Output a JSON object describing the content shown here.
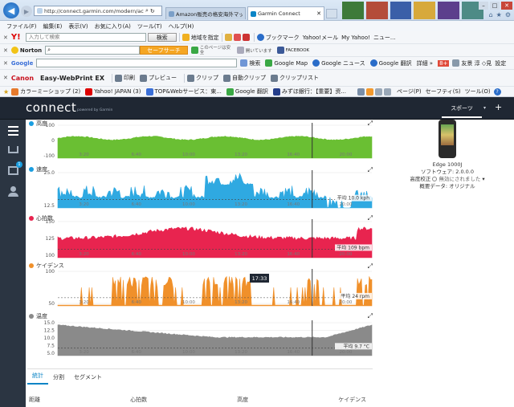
{
  "browser": {
    "url": "http://connect.garmin.com/modern/activity/",
    "tabs": [
      {
        "label": "Amazon販売の格安海外マッ...",
        "active": false
      },
      {
        "label": "Garmin Connect",
        "active": true
      }
    ],
    "menu": [
      "ファイル(F)",
      "編集(E)",
      "表示(V)",
      "お気に入り(A)",
      "ツール(T)",
      "ヘルプ(H)"
    ],
    "yahoo_toolbar": {
      "search_placeholder": "入力して検索",
      "search_button": "検索",
      "items": [
        "地域を指定",
        "ブックマーク",
        "Yahoo!メール",
        "My Yahoo!",
        "ニュー..."
      ]
    },
    "norton_toolbar": {
      "brand": "Norton",
      "safe_search": "セーフサーチ",
      "page_status": "このページは安全",
      "facebook_label": "FACEBOOK",
      "facebook_hint": "開いています"
    },
    "google_toolbar": {
      "brand": "Google",
      "items": [
        "検索",
        "Google Map",
        "Google ニュース",
        "Google 翻訳",
        "詳細 »"
      ],
      "account": "友景 淳 ◇見",
      "settings": "設定",
      "count": "8+"
    },
    "canon_toolbar": {
      "brand": "Canon",
      "product": "Easy-WebPrint EX",
      "items": [
        "印刷",
        "プレビュー",
        "クリップ",
        "自動クリップ",
        "クリップリスト"
      ]
    },
    "favorites": [
      "カラーミーショップ (2)",
      "Yahoo! JAPAN (3)",
      "TOP&Webサービス：東...",
      "Google 翻訳",
      "みずほ銀行：【重要】资..."
    ],
    "commands": [
      "ページ(P)",
      "セーフティ(S)",
      "ツール(O)"
    ]
  },
  "garmin": {
    "logo": "connect",
    "logo_sub": "powered by Garmin",
    "section": "スポーツ",
    "sidebar_badge": "1",
    "charts": [
      {
        "key": "elev",
        "label": "高度",
        "color": "#6abf33",
        "y_ticks": [
          "100",
          "0",
          "-100"
        ],
        "avg": ""
      },
      {
        "key": "speed",
        "label": "速度",
        "color": "#2fa9e1",
        "y_ticks": [
          "25.0",
          "12.5"
        ],
        "avg": "平均 10.0 kph"
      },
      {
        "key": "hr",
        "label": "心拍数",
        "color": "#e8244f",
        "y_ticks": [
          "150",
          "125",
          "100"
        ],
        "avg": "平均 109 bpm"
      },
      {
        "key": "cad",
        "label": "ケイデンス",
        "color": "#f0902a",
        "y_ticks": [
          "100",
          "50"
        ],
        "avg": "平均 24 rpm"
      },
      {
        "key": "temp",
        "label": "温度",
        "color": "#8a8a8a",
        "y_ticks": [
          "15.0",
          "12.5",
          "10.0",
          "7.5",
          "5.0"
        ],
        "avg": "平均 9.7 °C"
      }
    ],
    "x_ticks": [
      "3:20",
      "6:40",
      "10:00",
      "13:20",
      "16:40",
      "20:00"
    ],
    "hover_time": "17:33",
    "device": {
      "name": "Edge 1000J",
      "software": "ソフトウェア: 2.0.0.0",
      "elevation": "高度校正",
      "elevation_value": "無効にされました",
      "profile": "概要データ: オリジナル"
    },
    "tabs": [
      "統計",
      "分割",
      "セグメント"
    ],
    "stats_headers": [
      "距離",
      "心拍数",
      "高度",
      "ケイデンス"
    ]
  }
}
